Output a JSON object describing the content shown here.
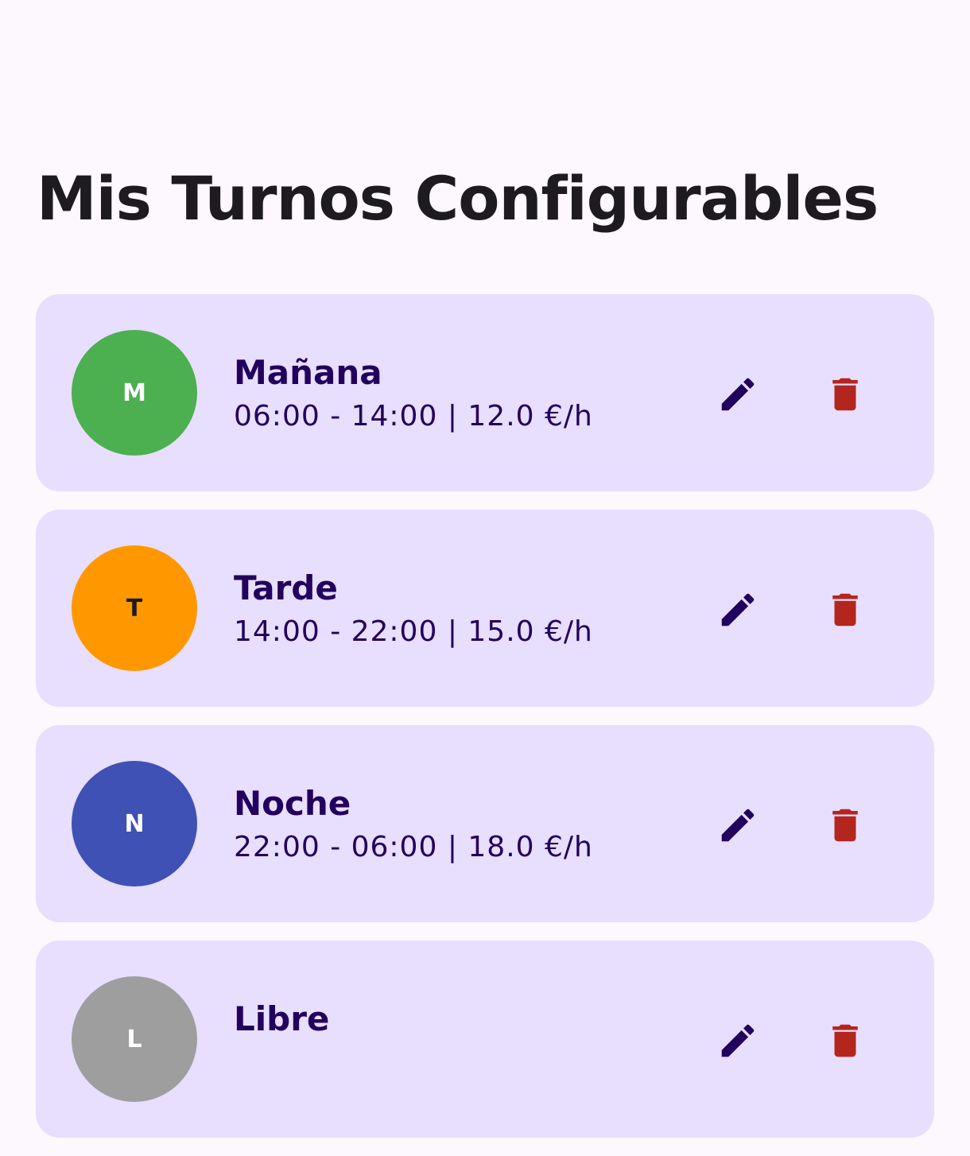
{
  "page": {
    "title": "Mis Turnos Configurables"
  },
  "colors": {
    "background": "#fdf7fe",
    "card": "#e8defd",
    "text": "#22005d",
    "delete": "#b3261e"
  },
  "shifts": [
    {
      "initial": "M",
      "name": "Mañana",
      "detail": "06:00 - 14:00 | 12.0 €/h",
      "avatar_color": "#4caf50",
      "initial_color": "#ffffff",
      "edit_icon": "pencil-icon",
      "delete_icon": "trash-icon"
    },
    {
      "initial": "T",
      "name": "Tarde",
      "detail": "14:00 - 22:00 | 15.0 €/h",
      "avatar_color": "#ff9800",
      "initial_color": "#1d1b20",
      "edit_icon": "pencil-icon",
      "delete_icon": "trash-icon"
    },
    {
      "initial": "N",
      "name": "Noche",
      "detail": "22:00 - 06:00 | 18.0 €/h",
      "avatar_color": "#3f51b5",
      "initial_color": "#ffffff",
      "edit_icon": "pencil-icon",
      "delete_icon": "trash-icon"
    },
    {
      "initial": "L",
      "name": "Libre",
      "detail": "",
      "avatar_color": "#9e9e9e",
      "initial_color": "#ffffff",
      "edit_icon": "pencil-icon",
      "delete_icon": "trash-icon"
    }
  ]
}
